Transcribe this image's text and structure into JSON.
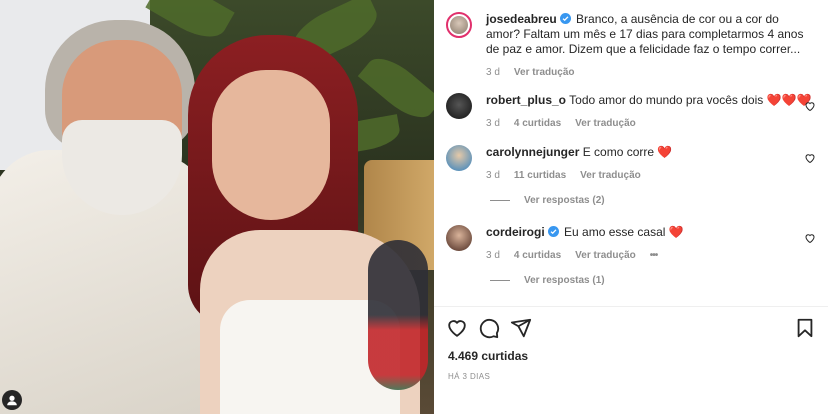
{
  "post": {
    "author": "josedeabreu",
    "caption": "Branco, a ausência de cor ou a cor do amor? Faltam um mês e 17 dias para completarmos 4 anos de paz e amor. Dizem que a felicidade faz o tempo correr...",
    "age": "3 d",
    "translate": "Ver tradução"
  },
  "comments": [
    {
      "user": "robert_plus_o",
      "text": "Todo amor do mundo pra vocês dois",
      "hearts": "❤️❤️❤️",
      "age": "3 d",
      "likes": "4 curtidas",
      "translate": "Ver tradução"
    },
    {
      "user": "carolynnejunger",
      "text": "E como corre",
      "hearts": "❤️",
      "age": "3 d",
      "likes": "11 curtidas",
      "translate": "Ver tradução",
      "replies": "Ver respostas (2)"
    },
    {
      "user": "cordeirogi",
      "text": "Eu amo esse casal",
      "hearts": "❤️",
      "age": "3 d",
      "likes": "4 curtidas",
      "translate": "Ver tradução",
      "more": "•••",
      "replies": "Ver respostas (1)"
    }
  ],
  "footer": {
    "likes": "4.469 curtidas",
    "time": "HÁ 3 DIAS"
  },
  "icons": {
    "like": "heart-outline-icon",
    "comment": "comment-icon",
    "share": "paper-plane-icon",
    "save": "bookmark-icon",
    "verified": "verified-badge-icon"
  },
  "colors": {
    "verified": "#3897f0",
    "heart": "#ed4956",
    "muted": "#8e8e8e"
  }
}
